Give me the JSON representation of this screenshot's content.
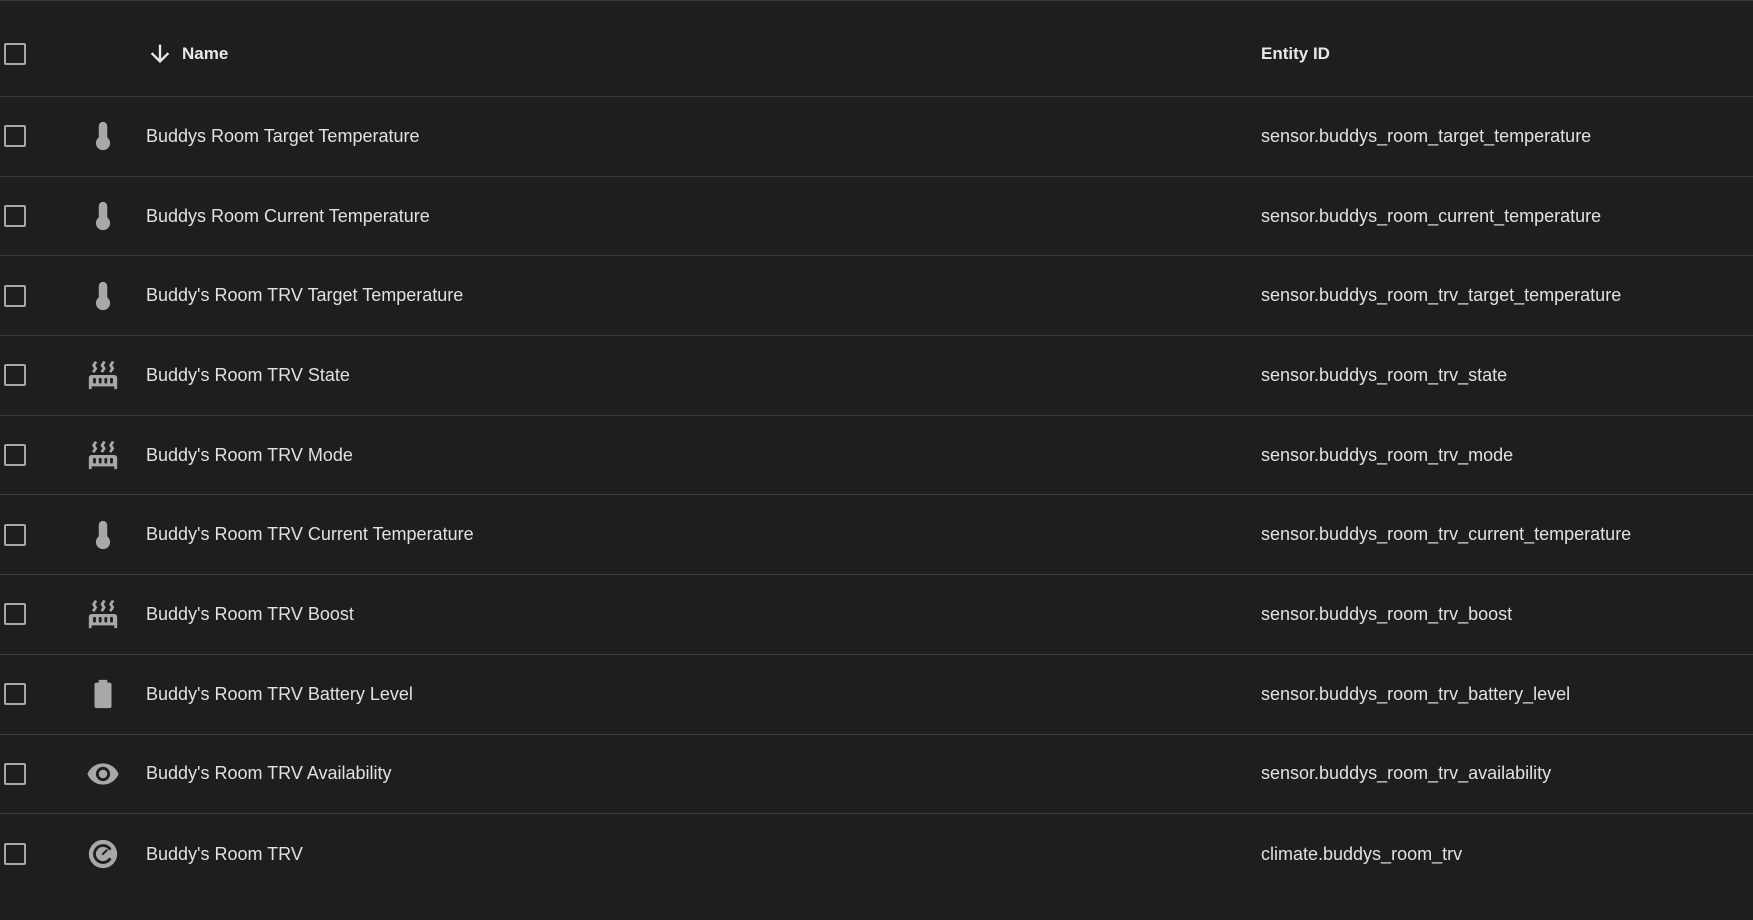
{
  "header": {
    "name_label": "Name",
    "entity_id_label": "Entity ID"
  },
  "rows": [
    {
      "icon": "thermometer-icon",
      "name": "Buddys Room Target Temperature",
      "entity_id": "sensor.buddys_room_target_temperature"
    },
    {
      "icon": "thermometer-icon",
      "name": "Buddys Room Current Temperature",
      "entity_id": "sensor.buddys_room_current_temperature"
    },
    {
      "icon": "thermometer-icon",
      "name": "Buddy's Room TRV Target Temperature",
      "entity_id": "sensor.buddys_room_trv_target_temperature"
    },
    {
      "icon": "radiator-icon",
      "name": "Buddy's Room TRV State",
      "entity_id": "sensor.buddys_room_trv_state"
    },
    {
      "icon": "radiator-icon",
      "name": "Buddy's Room TRV Mode",
      "entity_id": "sensor.buddys_room_trv_mode"
    },
    {
      "icon": "thermometer-icon",
      "name": "Buddy's Room TRV Current Temperature",
      "entity_id": "sensor.buddys_room_trv_current_temperature"
    },
    {
      "icon": "radiator-icon",
      "name": "Buddy's Room TRV Boost",
      "entity_id": "sensor.buddys_room_trv_boost"
    },
    {
      "icon": "battery-icon",
      "name": "Buddy's Room TRV Battery Level",
      "entity_id": "sensor.buddys_room_trv_battery_level"
    },
    {
      "icon": "eye-icon",
      "name": "Buddy's Room TRV Availability",
      "entity_id": "sensor.buddys_room_trv_availability"
    },
    {
      "icon": "thermostat-icon",
      "name": "Buddy's Room TRV",
      "entity_id": "climate.buddys_room_trv"
    }
  ],
  "colors": {
    "background": "#1e1e1e",
    "divider": "#3a3a3a",
    "icon": "#a8a8a8",
    "text": "#e1e1e1"
  }
}
